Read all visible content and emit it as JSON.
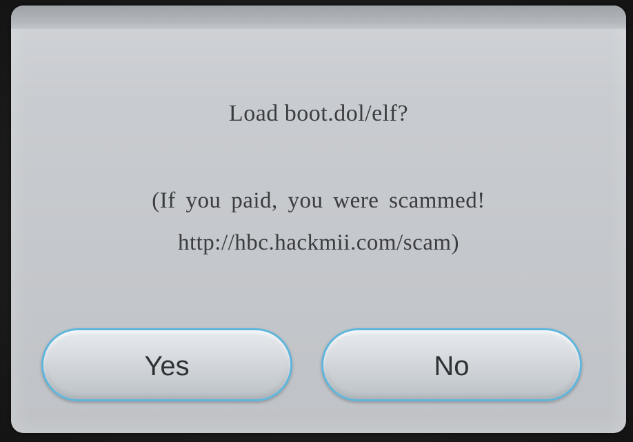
{
  "dialog": {
    "title": "Load boot.dol/elf?",
    "message_line1": "(If you paid, you were scammed!",
    "message_line2": "http://hbc.hackmii.com/scam)"
  },
  "buttons": {
    "yes_label": "Yes",
    "no_label": "No"
  },
  "colors": {
    "dialog_background": "#c6c9cd",
    "button_border": "#5fb6dc",
    "text": "#3a3c40"
  }
}
